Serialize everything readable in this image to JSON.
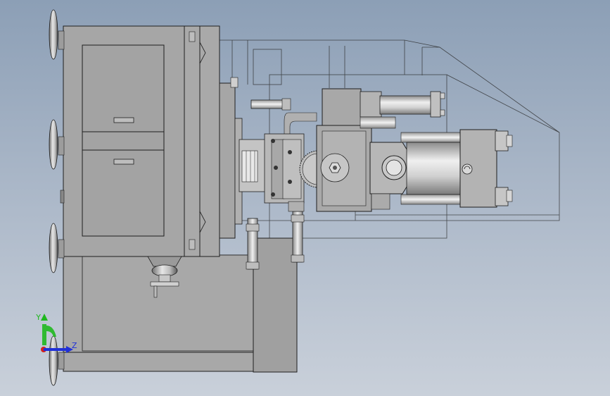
{
  "viewport": {
    "background_top": "#8c9fb6",
    "background_bottom": "#c9d0da"
  },
  "triad": {
    "y_label": "Y",
    "z_label": "Z",
    "y_color": "#1fb81f",
    "z_color": "#2030d8",
    "x_color": "#d02020"
  },
  "colors": {
    "body_gray": "#a3a3a3",
    "body_light": "#b8b8b8",
    "edge": "#1e1e1e",
    "steel": "#c8c8c8"
  }
}
